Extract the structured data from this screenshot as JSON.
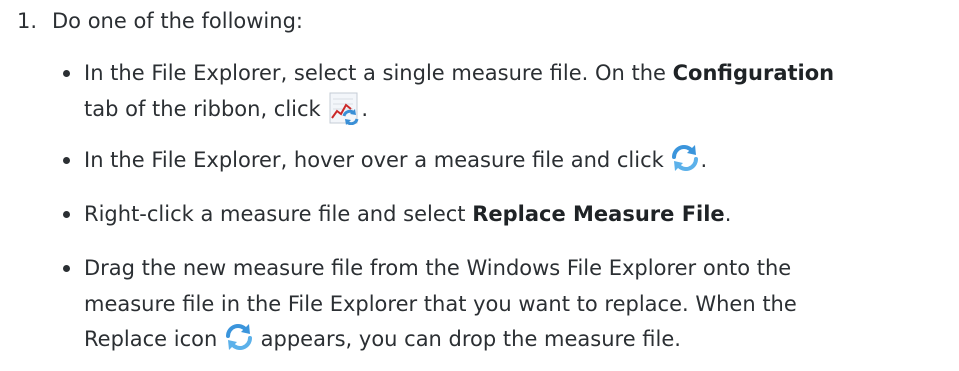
{
  "step": {
    "number": "1.",
    "text": "Do one of the following:"
  },
  "items": [
    {
      "line1_pre": "In the File Explorer, select a single measure file. On the ",
      "line1_bold": "Configuration",
      "line2_pre": "tab of the ribbon, click ",
      "line2_post": ".",
      "icon": "replace-measure-ribbon-icon"
    },
    {
      "pre": "In the File Explorer, hover over a measure file and click ",
      "post": ".",
      "icon": "replace-arrows-icon"
    },
    {
      "pre": "Right-click a measure file and select ",
      "bold": "Replace Measure File",
      "post": "."
    },
    {
      "line1": "Drag the new measure file from the Windows File Explorer onto the",
      "line2": "measure file in the File Explorer that you want to replace. When the",
      "line3_pre": "Replace icon ",
      "line3_post": " appears, you can drop the measure file.",
      "icon": "replace-arrows-icon"
    }
  ]
}
